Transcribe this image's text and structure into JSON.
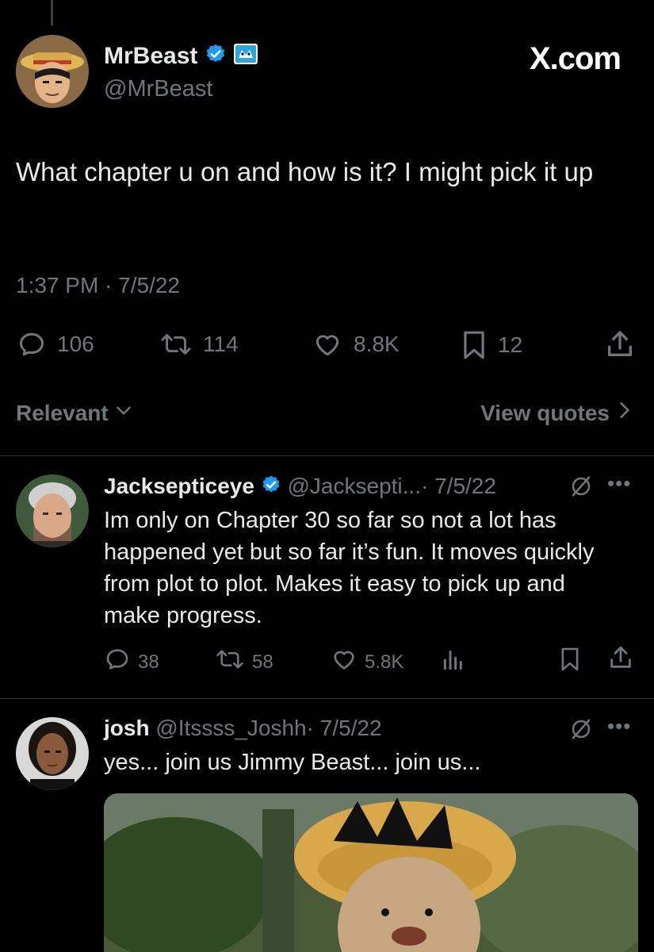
{
  "site": {
    "brand": "X.com"
  },
  "main_tweet": {
    "name": "MrBeast",
    "handle": "@MrBeast",
    "text": "What chapter u on and how is it? I might pick it up",
    "time": "1:37 PM · 7/5/22",
    "stats": {
      "replies": "106",
      "retweets": "114",
      "likes": "8.8K",
      "bookmarks": "12"
    }
  },
  "filters": {
    "sort_label": "Relevant",
    "quotes_label": "View quotes"
  },
  "replies": [
    {
      "name": "Jacksepticeye",
      "handle": "@Jacksepti...",
      "date": "· 7/5/22",
      "text": "Im only on Chapter 30 so far so not a lot has happened yet but so far it’s fun. It moves quickly from plot to plot. Makes it easy to pick up and make progress.",
      "stats": {
        "replies": "38",
        "retweets": "58",
        "likes": "5.8K"
      }
    },
    {
      "name": "josh",
      "handle": "@Itssss_Joshh",
      "date": "· 7/5/22",
      "text": "yes... join us Jimmy Beast... join us...",
      "media": "anime-character-image"
    }
  ],
  "colors": {
    "accent": "#1d9bf0",
    "muted": "#71767b",
    "text": "#e7e9ea",
    "background": "#000000"
  }
}
